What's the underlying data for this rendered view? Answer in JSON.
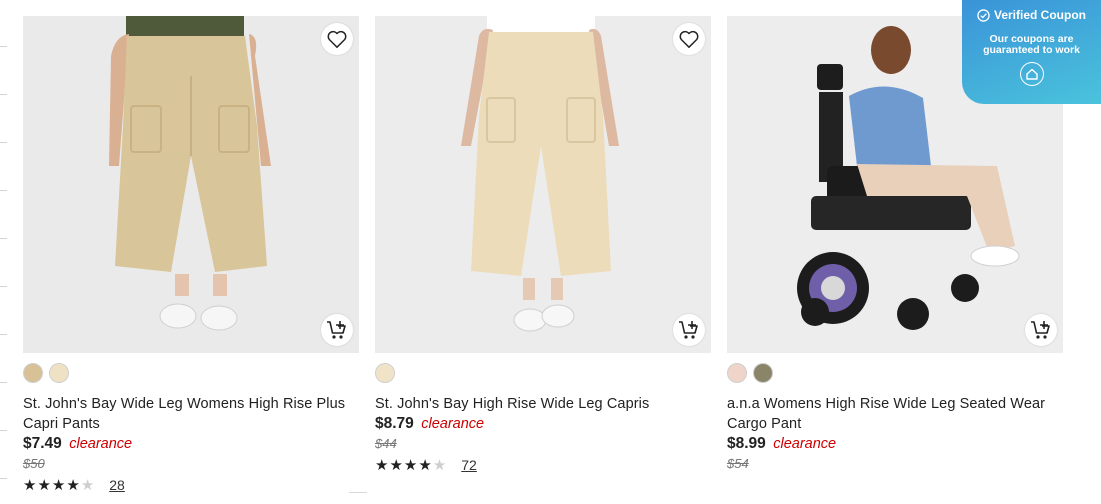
{
  "products": [
    {
      "title": "St. John's Bay Wide Leg Womens High Rise Plus Capri Pants",
      "price": "$7.49",
      "badge": "clearance",
      "was": "$50",
      "rating": 4,
      "reviews": "28",
      "swatches": [
        "#d8c196",
        "#efe2c4"
      ]
    },
    {
      "title": "St. John's Bay High Rise Wide Leg Capris",
      "price": "$8.79",
      "badge": "clearance",
      "was": "$44",
      "rating": 4,
      "reviews": "72",
      "swatches": [
        "#f0e3c8"
      ]
    },
    {
      "title": "a.n.a Womens High Rise Wide Leg Seated Wear Cargo Pant",
      "price": "$8.99",
      "badge": "clearance",
      "was": "$54",
      "swatches": [
        "#efd4c9",
        "#8a8468"
      ]
    }
  ],
  "coupon": {
    "title": "Verified Coupon",
    "text": "Our coupons are guaranteed to work"
  },
  "colors": {
    "clearance": "#cc0000",
    "coupon_start": "#3a93d8",
    "coupon_end": "#4ac3dc"
  },
  "icons": [
    "heart-icon",
    "add-to-cart-icon",
    "star-icon",
    "check-circle-icon",
    "house-icon"
  ]
}
